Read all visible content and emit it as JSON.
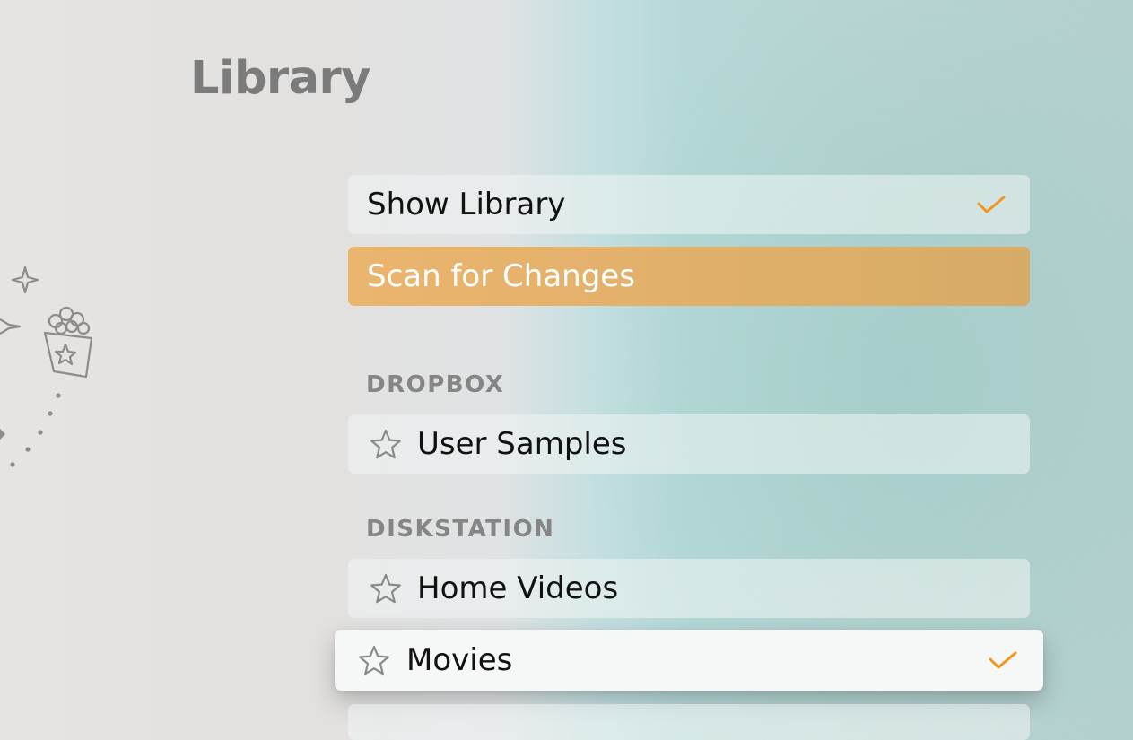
{
  "page": {
    "title": "Library"
  },
  "menu": {
    "show_library": {
      "label": "Show Library",
      "checked": true
    },
    "scan_for_changes": {
      "label": "Scan for Changes",
      "highlighted": true
    }
  },
  "sections": [
    {
      "header": "DROPBOX",
      "items": [
        {
          "label": "User Samples",
          "icon": "star-outline",
          "checked": false
        }
      ]
    },
    {
      "header": "DISKSTATION",
      "items": [
        {
          "label": "Home Videos",
          "icon": "star-outline",
          "checked": false
        },
        {
          "label": "Movies",
          "icon": "star-outline",
          "checked": true,
          "focused": true
        }
      ]
    }
  ],
  "colors": {
    "accent_orange": "#F0961E",
    "highlight_row": "#E3B068",
    "title_gray": "#7B7B7B",
    "section_header_gray": "#858585"
  },
  "decoration": {
    "icons": [
      "sparkle-icon",
      "popcorn-icon"
    ]
  }
}
